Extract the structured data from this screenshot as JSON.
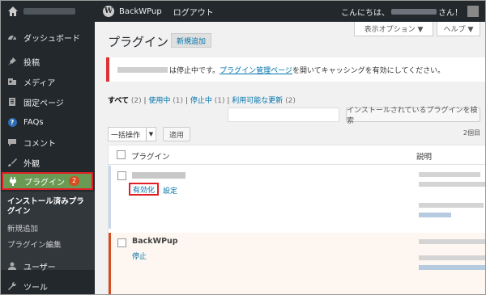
{
  "adminbar": {
    "site_name": "BackWPup",
    "logout": "ログアウト",
    "greeting_prefix": "こんにちは、",
    "greeting_suffix": "さん！"
  },
  "sidebar": {
    "items": [
      {
        "label": "ダッシュボード",
        "icon": "dashboard-icon"
      },
      {
        "label": "投稿",
        "icon": "pushpin-icon"
      },
      {
        "label": "メディア",
        "icon": "media-icon"
      },
      {
        "label": "固定ページ",
        "icon": "page-icon"
      },
      {
        "label": "FAQs",
        "icon": "question-icon"
      },
      {
        "label": "コメント",
        "icon": "comment-icon"
      },
      {
        "label": "外観",
        "icon": "brush-icon"
      },
      {
        "label": "プラグイン",
        "icon": "plug-icon",
        "badge": "2",
        "active": true
      },
      {
        "label": "ユーザー",
        "icon": "user-icon"
      },
      {
        "label": "ツール",
        "icon": "wrench-icon"
      }
    ],
    "submenu": [
      "インストール済みプラグイン",
      "新規追加",
      "プラグイン編集"
    ]
  },
  "header": {
    "screen_options": "表示オプション ▼",
    "help": "ヘルプ ▼",
    "title": "プラグイン",
    "add_new": "新規追加"
  },
  "notice": {
    "text_a": "は停止中です。",
    "link": "プラグイン管理ページ",
    "text_b": "を開いてキャッシングを有効にしてください。"
  },
  "filters": {
    "all": "すべて",
    "all_count": "(2)",
    "active": "使用中",
    "active_count": "(1)",
    "inactive": "停止中",
    "inactive_count": "(1)",
    "update": "利用可能な更新",
    "update_count": "(2)"
  },
  "search": {
    "button": "インストールされているプラグインを検索"
  },
  "bulk": {
    "label": "一括操作",
    "apply": "適用",
    "items_count": "2個目"
  },
  "table": {
    "col_plugin": "プラグイン",
    "col_desc": "説明",
    "rows": [
      {
        "actions": [
          "有効化",
          "設定"
        ]
      },
      {
        "name": "BackWPup",
        "actions": [
          "停止"
        ]
      }
    ]
  },
  "colors": {
    "adminbar": "#23282d",
    "active_menu": "#6a9a53",
    "highlight_border": "#e21f26",
    "link": "#0073aa",
    "notice_border": "#dc3232"
  }
}
